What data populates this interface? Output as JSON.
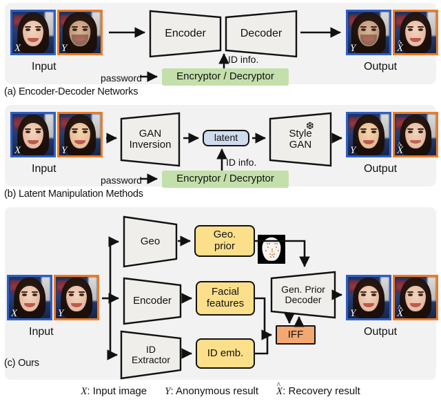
{
  "figure": {
    "background": "#ffffff",
    "panel_background": "#f2f2f2",
    "colors": {
      "green_box": "#c3e0ab",
      "yellow_box": "#fbdf8b",
      "orange_box": "#f3a871",
      "blue_box": "#cfdcee",
      "block_fill": "#efeeea",
      "border": "#111111",
      "frame_blue": "#2f5fc4",
      "frame_orange": "#f07a22"
    }
  },
  "panels": [
    {
      "id": "a",
      "caption": "(a) Encoder-Decoder Networks",
      "input_label": "Input",
      "output_label": "Output",
      "input_faces": [
        {
          "tag": "X",
          "frame": "blue"
        },
        {
          "tag": "Y",
          "frame": "orange"
        }
      ],
      "output_faces": [
        {
          "tag": "Y",
          "frame": "blue"
        },
        {
          "tag": "X̂",
          "frame": "orange"
        }
      ],
      "blocks": [
        {
          "name": "encoder",
          "label": "Encoder"
        },
        {
          "name": "decoder",
          "label": "Decoder"
        }
      ],
      "id_info_label": "ID info.",
      "password_label": "password",
      "crypto_label": "Encryptor / Decryptor"
    },
    {
      "id": "b",
      "caption": "(b) Latent Manipulation Methods",
      "input_label": "Input",
      "output_label": "Output",
      "input_faces": [
        {
          "tag": "X",
          "frame": "blue"
        },
        {
          "tag": "Y",
          "frame": "orange"
        }
      ],
      "output_faces": [
        {
          "tag": "Y",
          "frame": "blue"
        },
        {
          "tag": "X̂",
          "frame": "orange"
        }
      ],
      "blocks": [
        {
          "name": "gan-inversion",
          "label_line1": "GAN",
          "label_line2": "Inversion"
        },
        {
          "name": "style-gan",
          "label_line1": "Style",
          "label_line2": "GAN"
        }
      ],
      "latent_label": "latent",
      "frozen_icon": "snowflake-icon",
      "id_info_label": "ID info.",
      "password_label": "password",
      "crypto_label": "Encryptor / Decryptor"
    },
    {
      "id": "c",
      "caption": "(c) Ours",
      "input_label": "Input",
      "output_label": "Output",
      "input_faces": [
        {
          "tag": "X",
          "frame": "blue"
        },
        {
          "tag": "Y",
          "frame": "orange"
        }
      ],
      "output_faces": [
        {
          "tag": "Y",
          "frame": "blue"
        },
        {
          "tag": "X̂",
          "frame": "orange"
        }
      ],
      "blocks": [
        {
          "name": "geo",
          "label": "Geo"
        },
        {
          "name": "encoder",
          "label": "Encoder"
        },
        {
          "name": "id-extractor",
          "label_line1": "ID",
          "label_line2": "Extractor"
        },
        {
          "name": "gen-prior-decoder",
          "label_line1": "Gen. Prior",
          "label_line2": "Decoder"
        }
      ],
      "boxes": [
        {
          "name": "geo-prior",
          "label_line1": "Geo.",
          "label_line2": "prior",
          "color": "yellow"
        },
        {
          "name": "facial-features",
          "label_line1": "Facial",
          "label_line2": "features",
          "color": "yellow"
        },
        {
          "name": "id-emb",
          "label": "ID emb.",
          "color": "yellow"
        },
        {
          "name": "iff",
          "label": "IFF",
          "color": "orange"
        }
      ],
      "landmark_thumb": "face-landmark-thumbnail"
    }
  ],
  "legend": {
    "items": [
      {
        "symbol": "X",
        "hat": false,
        "text": ": Input image"
      },
      {
        "symbol": "Y",
        "hat": false,
        "text": ": Anonymous result"
      },
      {
        "symbol": "X",
        "hat": true,
        "text": ": Recovery result"
      }
    ]
  }
}
